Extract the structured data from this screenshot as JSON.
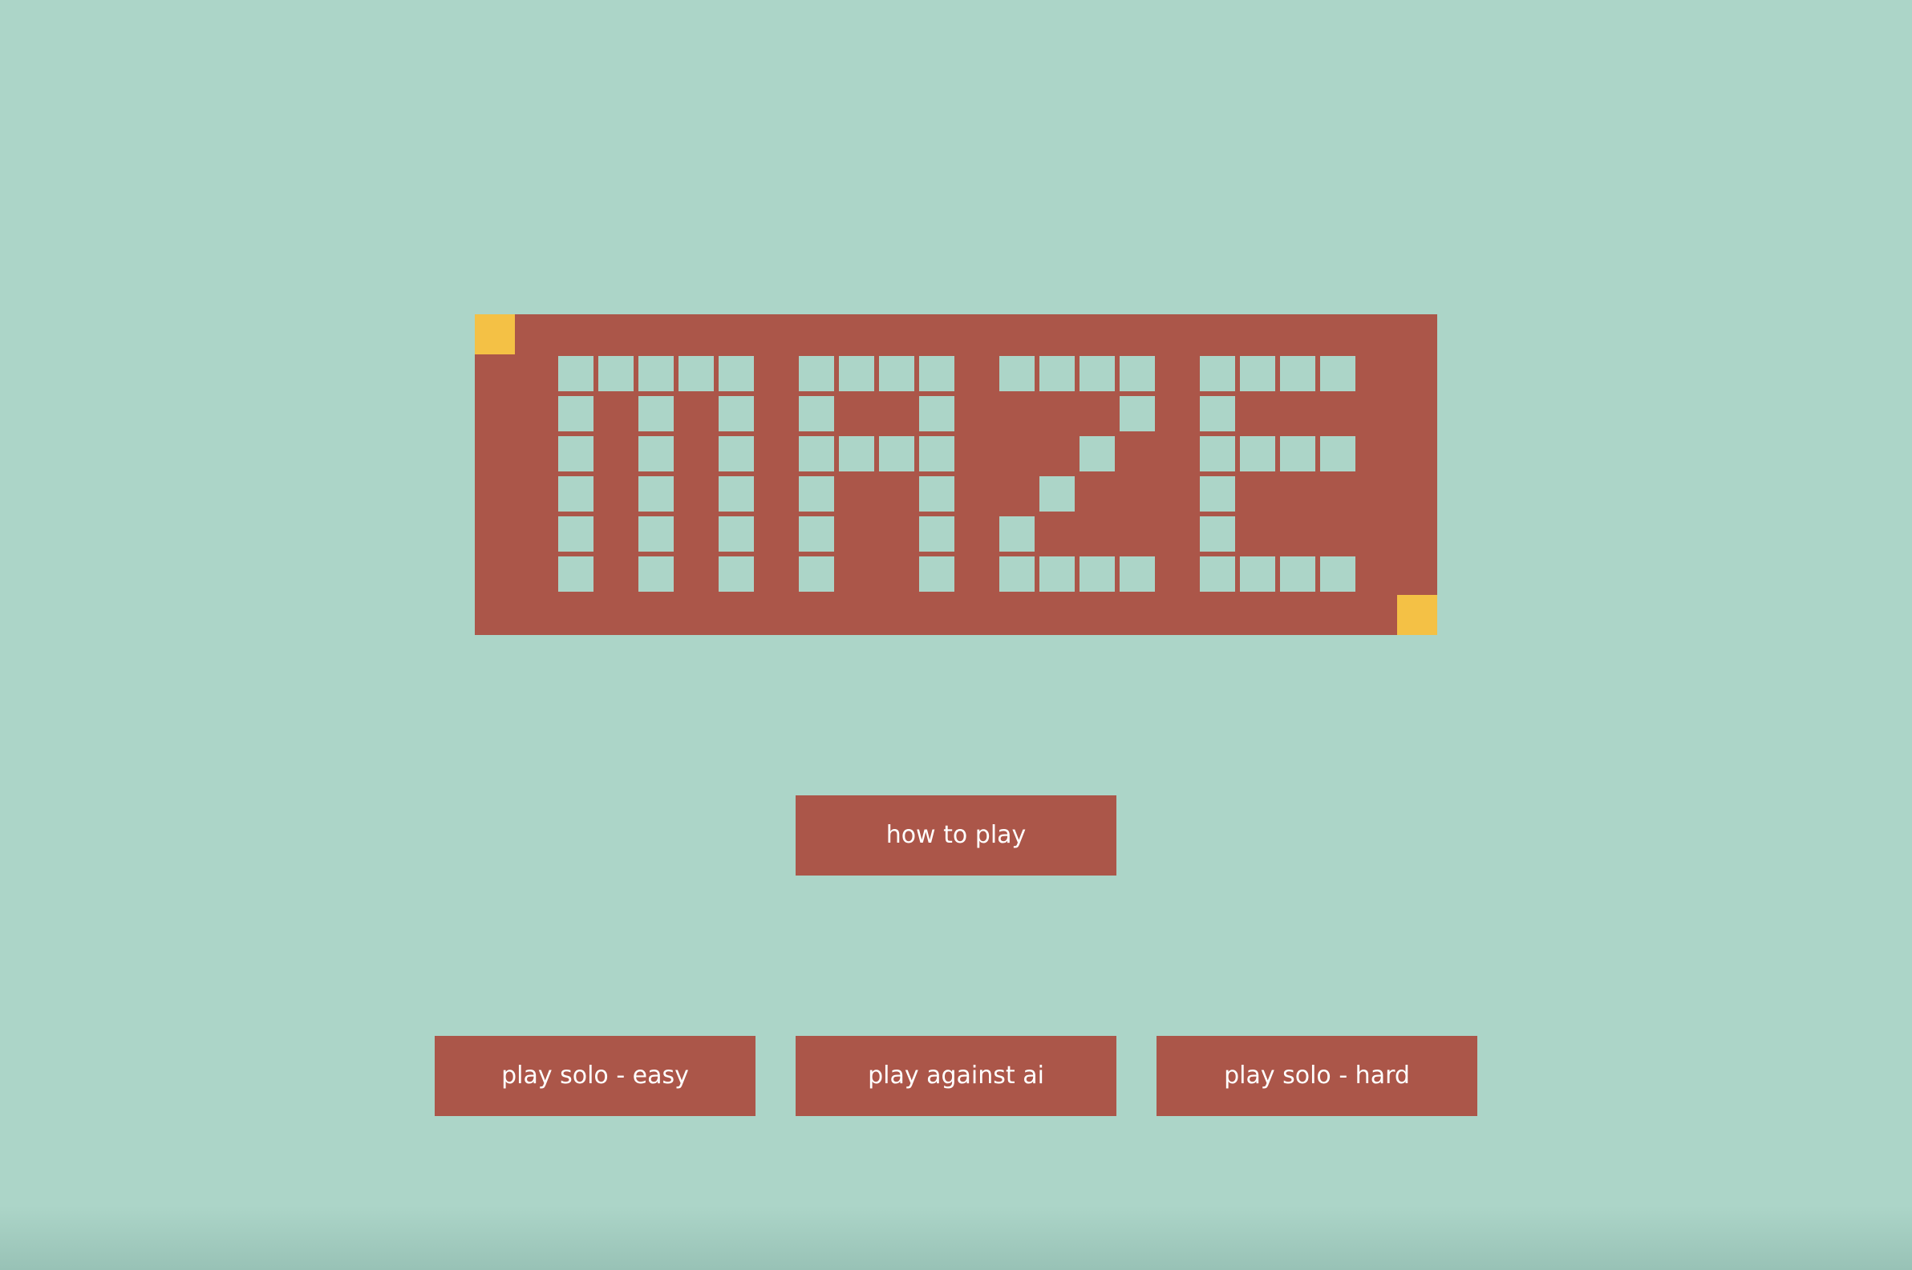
{
  "title": {
    "text": "MAZE",
    "grid_letters": [
      [
        "11111",
        "10101",
        "10101",
        "10101",
        "10101",
        "10101"
      ],
      [
        "1111",
        "1001",
        "1111",
        "1001",
        "1001",
        "1001"
      ],
      [
        "1111",
        "0001",
        "0010",
        "0100",
        "1000",
        "1111"
      ],
      [
        "1111",
        "1000",
        "1111",
        "1000",
        "1000",
        "1111"
      ]
    ]
  },
  "buttons": {
    "how_to_play": "how to play",
    "play_solo_easy": "play solo - easy",
    "play_against_ai": "play against ai",
    "play_solo_hard": "play solo - hard"
  },
  "colors": {
    "background": "#acd5c8",
    "accent": "#ab5649",
    "marker": "#f4c145",
    "button_text": "#ffffff"
  }
}
